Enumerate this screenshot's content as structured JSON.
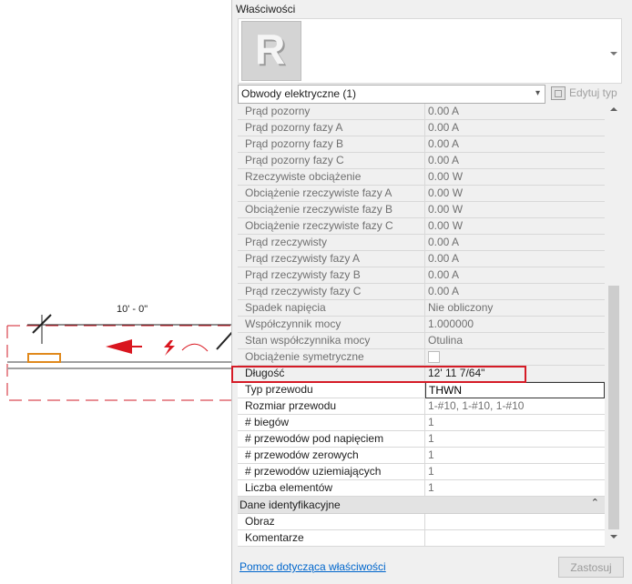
{
  "drawing": {
    "dimension_text": "10' - 0\""
  },
  "panel": {
    "title": "Właściwości",
    "type_logo": "R",
    "selector_value": "Obwody elektryczne (1)",
    "edit_type_label": "Edytuj typ",
    "help_link": "Pomoc dotycząca właściwości",
    "apply_button": "Zastosuj"
  },
  "properties": [
    {
      "label": "Prąd pozorny",
      "value": "0.00 A"
    },
    {
      "label": "Prąd pozorny fazy A",
      "value": "0.00 A"
    },
    {
      "label": "Prąd pozorny fazy B",
      "value": "0.00 A"
    },
    {
      "label": "Prąd pozorny fazy C",
      "value": "0.00 A"
    },
    {
      "label": "Rzeczywiste obciążenie",
      "value": "0.00 W"
    },
    {
      "label": "Obciążenie rzeczywiste fazy A",
      "value": "0.00 W"
    },
    {
      "label": "Obciążenie rzeczywiste fazy B",
      "value": "0.00 W"
    },
    {
      "label": "Obciążenie rzeczywiste fazy C",
      "value": "0.00 W"
    },
    {
      "label": "Prąd rzeczywisty",
      "value": "0.00 A"
    },
    {
      "label": "Prąd rzeczywisty fazy A",
      "value": "0.00 A"
    },
    {
      "label": "Prąd rzeczywisty fazy B",
      "value": "0.00 A"
    },
    {
      "label": "Prąd rzeczywisty fazy C",
      "value": "0.00 A"
    },
    {
      "label": "Spadek napięcia",
      "value": "Nie obliczony"
    },
    {
      "label": "Współczynnik mocy",
      "value": "1.000000"
    },
    {
      "label": "Stan współczynnika mocy",
      "value": "Otulina"
    },
    {
      "label": "Obciążenie symetryczne",
      "value": ""
    },
    {
      "label": "Długość",
      "value": "12'  11 7/64\""
    },
    {
      "label": "Typ przewodu",
      "value": "THWN"
    },
    {
      "label": "Rozmiar przewodu",
      "value": "1-#10, 1-#10, 1-#10"
    },
    {
      "label": "# biegów",
      "value": "1"
    },
    {
      "label": "# przewodów pod napięciem",
      "value": "1"
    },
    {
      "label": "# przewodów zerowych",
      "value": "1"
    },
    {
      "label": "# przewodów uziemiających",
      "value": "1"
    },
    {
      "label": "Liczba elementów",
      "value": "1"
    }
  ],
  "identity_group": {
    "title": "Dane identyfikacyjne",
    "rows": [
      {
        "label": "Obraz",
        "value": ""
      },
      {
        "label": "Komentarze",
        "value": ""
      }
    ]
  }
}
